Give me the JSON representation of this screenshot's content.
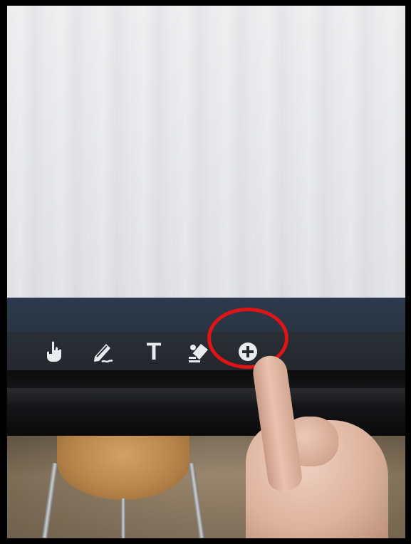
{
  "toolbar": {
    "tools": [
      {
        "icon": "hand-pointer-icon"
      },
      {
        "icon": "pen-icon"
      },
      {
        "icon": "text-tool-icon",
        "glyph": "T"
      },
      {
        "icon": "eraser-icon"
      },
      {
        "icon": "add-circle-icon"
      }
    ]
  },
  "annotation": {
    "color": "#e01414"
  },
  "colors": {
    "screen": "#e6e7ea",
    "toolbar": "#26292e",
    "band": "#2b3847",
    "icon": "#e9ecef"
  }
}
